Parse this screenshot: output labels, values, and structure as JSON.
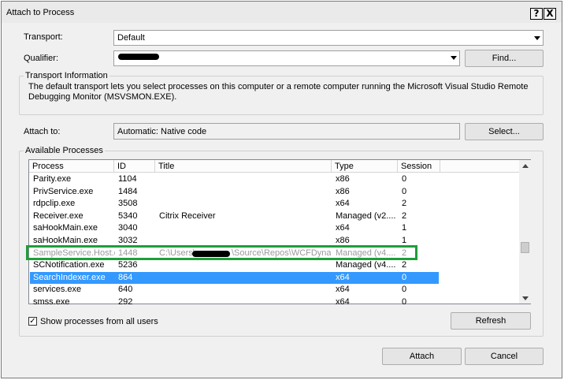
{
  "window": {
    "title": "Attach to Process",
    "help_button": "?",
    "close_button": "X"
  },
  "transport": {
    "label": "Transport:",
    "value": "Default"
  },
  "qualifier": {
    "label": "Qualifier:",
    "value": "",
    "find_button": "Find..."
  },
  "transport_info": {
    "group_label": "Transport Information",
    "text": "The default transport lets you select processes on this computer or a remote computer running the Microsoft Visual Studio Remote Debugging Monitor (MSVSMON.EXE)."
  },
  "attach_to": {
    "label": "Attach to:",
    "value": "Automatic: Native code",
    "select_button": "Select..."
  },
  "available_processes": {
    "group_label": "Available Processes",
    "columns": [
      "Process",
      "ID",
      "Title",
      "Type",
      "Session"
    ],
    "rows": [
      {
        "process": "Parity.exe",
        "id": "1104",
        "title": "",
        "type": "x86",
        "session": "0"
      },
      {
        "process": "PrivService.exe",
        "id": "1484",
        "title": "",
        "type": "x86",
        "session": "0"
      },
      {
        "process": "rdpclip.exe",
        "id": "3508",
        "title": "",
        "type": "x64",
        "session": "2"
      },
      {
        "process": "Receiver.exe",
        "id": "5340",
        "title": "Citrix Receiver",
        "type": "Managed (v2....",
        "session": "2"
      },
      {
        "process": "saHookMain.exe",
        "id": "3040",
        "title": "",
        "type": "x64",
        "session": "1"
      },
      {
        "process": "saHookMain.exe",
        "id": "3032",
        "title": "",
        "type": "x86",
        "session": "1"
      },
      {
        "process": "SampleService.Host.exe",
        "id": "1448",
        "title": "C:\\Users\\",
        "title_rest": "\\Source\\Repos\\WCFDyna...",
        "type": "Managed (v4....",
        "session": "2"
      },
      {
        "process": "SCNotification.exe",
        "id": "5236",
        "title": "",
        "type": "Managed (v4....",
        "session": "2"
      },
      {
        "process": "SearchIndexer.exe",
        "id": "864",
        "title": "",
        "type": "x64",
        "session": "0"
      },
      {
        "process": "services.exe",
        "id": "640",
        "title": "",
        "type": "x64",
        "session": "0"
      },
      {
        "process": "smss.exe",
        "id": "292",
        "title": "",
        "type": "x64",
        "session": "0"
      }
    ],
    "selected_index": 8,
    "highlighted_index": 6,
    "show_all_label": "Show processes from all users",
    "show_all_checked": true,
    "check_mark": "✓",
    "refresh_button": "Refresh"
  },
  "footer": {
    "attach_button": "Attach",
    "cancel_button": "Cancel"
  },
  "colors": {
    "selection": "#3399ff",
    "highlight_outline": "#1f9e3a"
  }
}
